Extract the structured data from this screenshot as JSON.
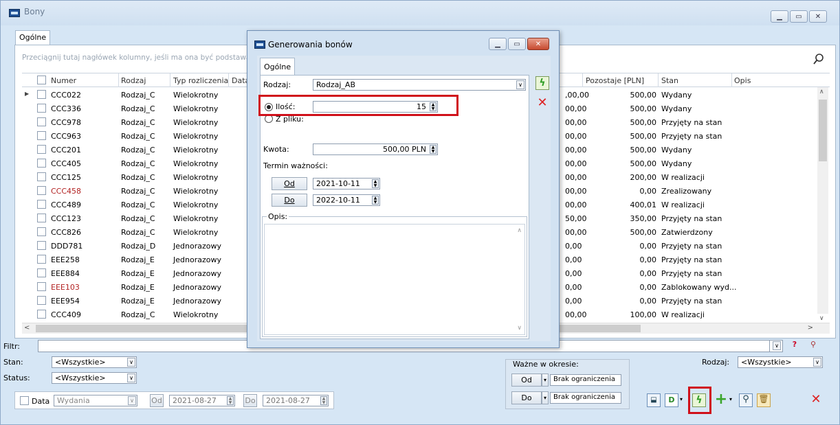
{
  "window": {
    "title": "Bony",
    "tab": "Ogólne",
    "hint": "Przeciągnij tutaj nagłówek kolumny, jeśli ma ona być podstawą grupo"
  },
  "columns": [
    "Numer",
    "Rodzaj",
    "Typ rozliczenia",
    "Data",
    "Pozostaje [PLN]",
    "Stan",
    "Opis"
  ],
  "rows": [
    {
      "numer": "CCC022",
      "rodzaj": "Rodzaj_C",
      "typ": "Wielokrotny",
      "kwota": ",00,00",
      "pozostaje": "500,00",
      "stan": "Wydany",
      "red": false
    },
    {
      "numer": "CCC336",
      "rodzaj": "Rodzaj_C",
      "typ": "Wielokrotny",
      "kwota": "00,00",
      "pozostaje": "500,00",
      "stan": "Wydany",
      "red": false
    },
    {
      "numer": "CCC978",
      "rodzaj": "Rodzaj_C",
      "typ": "Wielokrotny",
      "kwota": "00,00",
      "pozostaje": "500,00",
      "stan": "Przyjęty na stan",
      "red": false
    },
    {
      "numer": "CCC963",
      "rodzaj": "Rodzaj_C",
      "typ": "Wielokrotny",
      "kwota": "00,00",
      "pozostaje": "500,00",
      "stan": "Przyjęty na stan",
      "red": false
    },
    {
      "numer": "CCC201",
      "rodzaj": "Rodzaj_C",
      "typ": "Wielokrotny",
      "kwota": "00,00",
      "pozostaje": "500,00",
      "stan": "Wydany",
      "red": false
    },
    {
      "numer": "CCC405",
      "rodzaj": "Rodzaj_C",
      "typ": "Wielokrotny",
      "kwota": "00,00",
      "pozostaje": "500,00",
      "stan": "Wydany",
      "red": false
    },
    {
      "numer": "CCC125",
      "rodzaj": "Rodzaj_C",
      "typ": "Wielokrotny",
      "kwota": "00,00",
      "pozostaje": "200,00",
      "stan": "W realizacji",
      "red": false
    },
    {
      "numer": "CCC458",
      "rodzaj": "Rodzaj_C",
      "typ": "Wielokrotny",
      "kwota": "00,00",
      "pozostaje": "0,00",
      "stan": "Zrealizowany",
      "red": true
    },
    {
      "numer": "CCC489",
      "rodzaj": "Rodzaj_C",
      "typ": "Wielokrotny",
      "kwota": "00,00",
      "pozostaje": "400,01",
      "stan": "W realizacji",
      "red": false
    },
    {
      "numer": "CCC123",
      "rodzaj": "Rodzaj_C",
      "typ": "Wielokrotny",
      "kwota": "50,00",
      "pozostaje": "350,00",
      "stan": "Przyjęty na stan",
      "red": false
    },
    {
      "numer": "CCC826",
      "rodzaj": "Rodzaj_C",
      "typ": "Wielokrotny",
      "kwota": "00,00",
      "pozostaje": "500,00",
      "stan": "Zatwierdzony",
      "red": false
    },
    {
      "numer": "DDD781",
      "rodzaj": "Rodzaj_D",
      "typ": "Jednorazowy",
      "kwota": "0,00",
      "pozostaje": "0,00",
      "stan": "Przyjęty na stan",
      "red": false
    },
    {
      "numer": "EEE258",
      "rodzaj": "Rodzaj_E",
      "typ": "Jednorazowy",
      "kwota": "0,00",
      "pozostaje": "0,00",
      "stan": "Przyjęty na stan",
      "red": false
    },
    {
      "numer": "EEE884",
      "rodzaj": "Rodzaj_E",
      "typ": "Jednorazowy",
      "kwota": "0,00",
      "pozostaje": "0,00",
      "stan": "Przyjęty na stan",
      "red": false
    },
    {
      "numer": "EEE103",
      "rodzaj": "Rodzaj_E",
      "typ": "Jednorazowy",
      "kwota": "0,00",
      "pozostaje": "0,00",
      "stan": "Zablokowany wyd...",
      "red": true
    },
    {
      "numer": "EEE954",
      "rodzaj": "Rodzaj_E",
      "typ": "Jednorazowy",
      "kwota": "0,00",
      "pozostaje": "0,00",
      "stan": "Przyjęty na stan",
      "red": false
    },
    {
      "numer": "CCC409",
      "rodzaj": "Rodzaj_C",
      "typ": "Wielokrotny",
      "kwota": "00,00",
      "pozostaje": "100,00",
      "stan": "W realizacji",
      "red": false
    }
  ],
  "dialog": {
    "title": "Generowania bonów",
    "tab": "Ogólne",
    "rodzaj_label": "Rodzaj:",
    "rodzaj_value": "Rodzaj_AB",
    "ilosc_label": "Ilość:",
    "ilosc_value": "15",
    "zpliku_label": "Z pliku:",
    "kwota_label": "Kwota:",
    "kwota_value": "500,00 PLN",
    "termin_label": "Termin ważności:",
    "od_label": "Od",
    "od_value": "2021-10-11",
    "do_label": "Do",
    "do_value": "2022-10-11",
    "opis_label": "Opis:"
  },
  "filters": {
    "filtr_label": "Filtr:",
    "stan_label": "Stan:",
    "stan_value": "<Wszystkie>",
    "status_label": "Status:",
    "status_value": "<Wszystkie>",
    "data_label": "Data",
    "data_type": "Wydania",
    "od_label": "Od",
    "od_value": "2021-08-27",
    "do_label": "Do",
    "do_value": "2021-08-27",
    "wazne_label": "Ważne w okresie:",
    "wazne_od_label": "Od",
    "wazne_od_value": "Brak ograniczenia",
    "wazne_do_label": "Do",
    "wazne_do_value": "Brak ograniczenia",
    "rodzaj_label": "Rodzaj:",
    "rodzaj_value": "<Wszystkie>"
  }
}
